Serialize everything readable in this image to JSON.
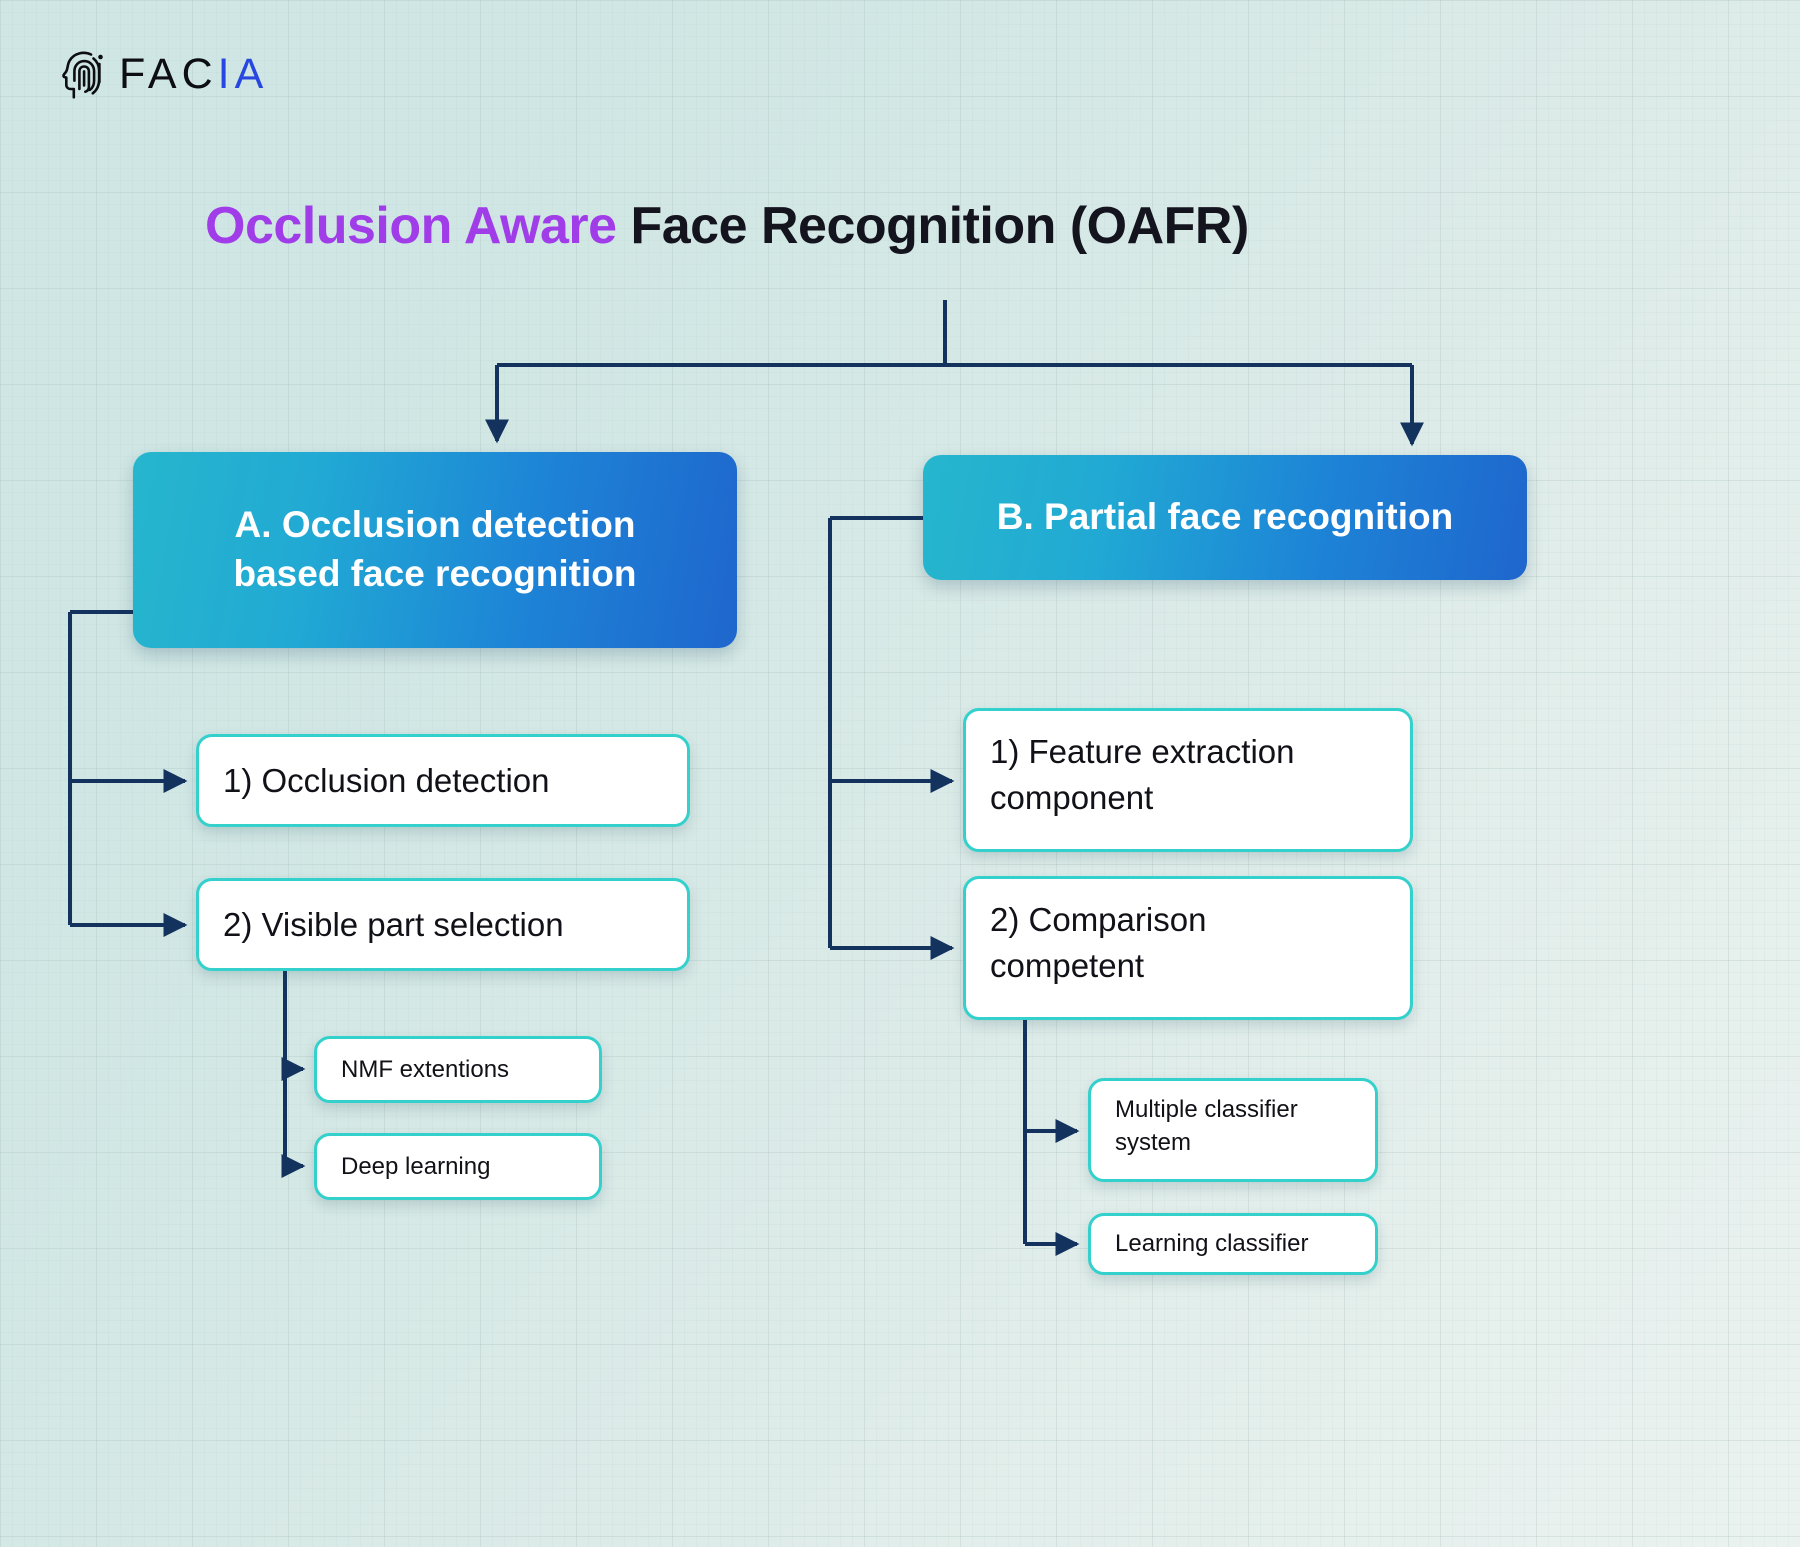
{
  "brand": {
    "icon": "fingerprint-face-logo",
    "name_dark": "FAC",
    "name_blue": "IA",
    "logo_blue": "#2747e0"
  },
  "title": {
    "accent_text": "Occlusion Aware",
    "plain_text": " Face Recognition (OAFR)",
    "accent_color": "#a03ce8",
    "plain_color": "#14141e"
  },
  "theme": {
    "background_start": "#cfe6e4",
    "background_end": "#eaf2ef",
    "primary_gradient_from": "#26b6cd",
    "primary_gradient_to": "#1f66cd",
    "white_box_border": "#34d0cc",
    "connector_color": "#13335e"
  },
  "diagram": {
    "type": "hierarchy-tree",
    "root": "Occlusion Aware Face Recognition (OAFR)",
    "branches": [
      {
        "id": "A",
        "label": "A. Occlusion detection based face recognition",
        "label_line1": "A. Occlusion detection",
        "label_line2": "based face recognition",
        "children": [
          {
            "id": "A1",
            "label": "1) Occlusion detection",
            "children": []
          },
          {
            "id": "A2",
            "label": "2) Visible part selection",
            "children": [
              {
                "id": "A2a",
                "label": "NMF extentions"
              },
              {
                "id": "A2b",
                "label": "Deep learning"
              }
            ]
          }
        ]
      },
      {
        "id": "B",
        "label": "B. Partial face recognition",
        "label_line1": "B. Partial face recognition",
        "label_line2": "",
        "children": [
          {
            "id": "B1",
            "label": "1) Feature extraction component",
            "label_line1": "1) Feature extraction",
            "label_line2": "component",
            "children": []
          },
          {
            "id": "B2",
            "label": "2) Comparison competent",
            "label_line1": "2) Comparison",
            "label_line2": "competent",
            "children": [
              {
                "id": "B2a",
                "label": "Multiple classifier system",
                "label_line1": "Multiple classifier",
                "label_line2": "system"
              },
              {
                "id": "B2b",
                "label": "Learning classifier"
              }
            ]
          }
        ]
      }
    ]
  }
}
